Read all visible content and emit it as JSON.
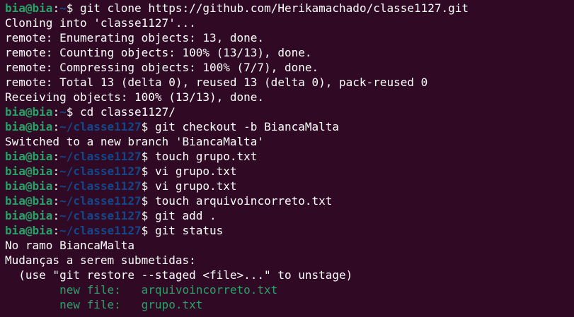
{
  "terminal": {
    "background": "#300a24",
    "prompt_user_color": "#26a269",
    "prompt_path_color": "#12488b",
    "staged_color": "#26a269",
    "lines": [
      {
        "kind": "prompt",
        "user": "bia@bia",
        "path": "~",
        "cmd": " git clone https://github.com/Herikamachado/classe1127.git"
      },
      {
        "kind": "out",
        "text": "Cloning into 'classe1127'..."
      },
      {
        "kind": "out",
        "text": "remote: Enumerating objects: 13, done."
      },
      {
        "kind": "out",
        "text": "remote: Counting objects: 100% (13/13), done."
      },
      {
        "kind": "out",
        "text": "remote: Compressing objects: 100% (7/7), done."
      },
      {
        "kind": "out",
        "text": "remote: Total 13 (delta 0), reused 13 (delta 0), pack-reused 0"
      },
      {
        "kind": "out",
        "text": "Receiving objects: 100% (13/13), done."
      },
      {
        "kind": "prompt",
        "user": "bia@bia",
        "path": "~",
        "cmd": " cd classe1127/"
      },
      {
        "kind": "prompt",
        "user": "bia@bia",
        "path": "~/classe1127",
        "cmd": " git checkout -b BiancaMalta"
      },
      {
        "kind": "out",
        "text": "Switched to a new branch 'BiancaMalta'"
      },
      {
        "kind": "prompt",
        "user": "bia@bia",
        "path": "~/classe1127",
        "cmd": " touch grupo.txt"
      },
      {
        "kind": "prompt",
        "user": "bia@bia",
        "path": "~/classe1127",
        "cmd": " vi grupo.txt"
      },
      {
        "kind": "prompt",
        "user": "bia@bia",
        "path": "~/classe1127",
        "cmd": " vi grupo.txt"
      },
      {
        "kind": "prompt",
        "user": "bia@bia",
        "path": "~/classe1127",
        "cmd": " touch arquivoincorreto.txt"
      },
      {
        "kind": "prompt",
        "user": "bia@bia",
        "path": "~/classe1127",
        "cmd": " git add ."
      },
      {
        "kind": "prompt",
        "user": "bia@bia",
        "path": "~/classe1127",
        "cmd": " git status"
      },
      {
        "kind": "out",
        "text": "No ramo BiancaMalta"
      },
      {
        "kind": "out",
        "text": "Mudanças a serem submetidas:"
      },
      {
        "kind": "out",
        "text": "  (use \"git restore --staged <file>...\" to unstage)"
      },
      {
        "kind": "staged",
        "text": "        new file:   arquivoincorreto.txt"
      },
      {
        "kind": "staged",
        "text": "        new file:   grupo.txt"
      }
    ]
  }
}
